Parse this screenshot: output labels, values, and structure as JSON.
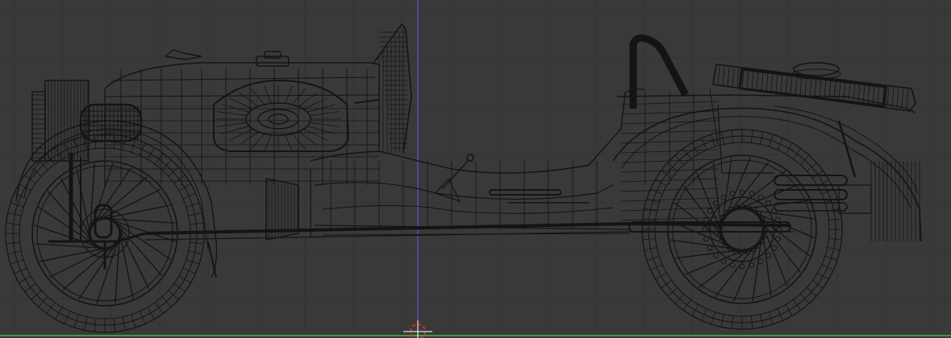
{
  "viewport": {
    "view": "side-orthographic",
    "shading": "wireframe",
    "colors": {
      "background": "#393939",
      "grid_line": "#343434",
      "wire": "#141414",
      "wire_dense": "#0c0c0c",
      "axis_vertical": "#5a5aff",
      "axis_horizontal": "#3f9a3f",
      "cursor_ring": "#d43030",
      "cursor_cross": "#ffffff"
    },
    "icons": {
      "cursor": "3d-cursor-icon",
      "model": "wireframe-car-model"
    }
  }
}
